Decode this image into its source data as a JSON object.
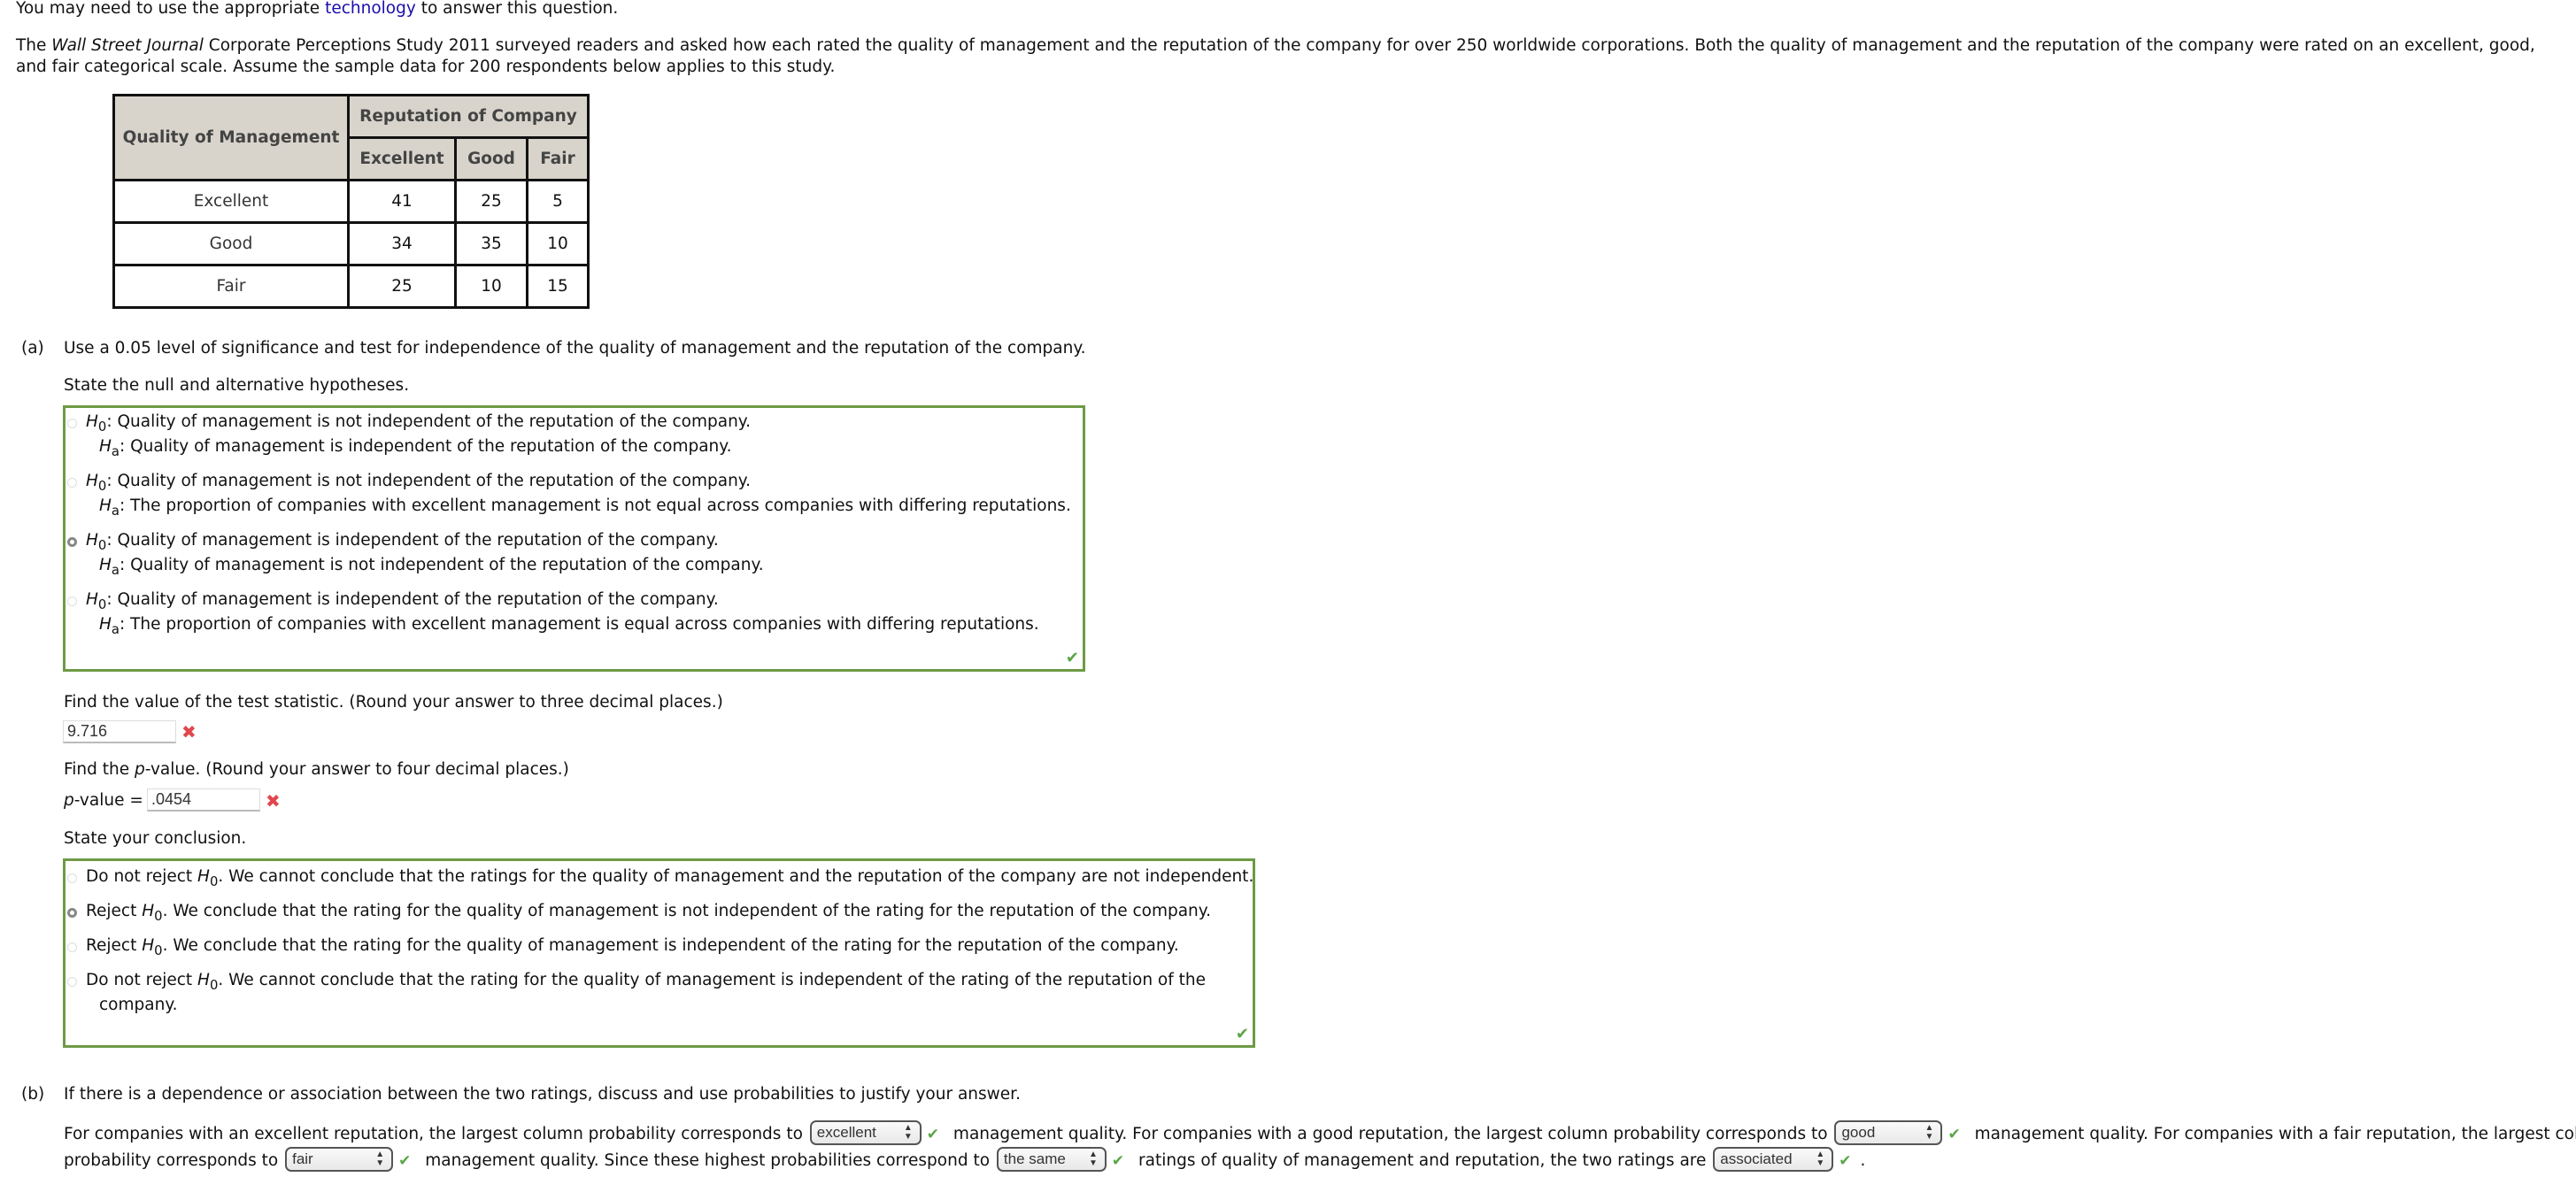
{
  "header": {
    "tech_prefix": "You may need to use the appropriate ",
    "tech_link": "technology",
    "tech_suffix": " to answer this question."
  },
  "intro": {
    "part1": "The ",
    "journal": "Wall Street Journal",
    "part2": " Corporate Perceptions Study 2011 surveyed readers and asked how each rated the quality of management and the reputation of the company for over 250 worldwide corporations. Both the quality of management and the reputation of the company were rated on an excellent, good, and fair categorical scale. Assume the sample data for 200 respondents below applies to this study."
  },
  "table": {
    "row_header": "Quality of Management",
    "col_group_header": "Reputation of Company",
    "columns": [
      "Excellent",
      "Good",
      "Fair"
    ],
    "rows": [
      {
        "label": "Excellent",
        "values": [
          "41",
          "25",
          "5"
        ]
      },
      {
        "label": "Good",
        "values": [
          "34",
          "35",
          "10"
        ]
      },
      {
        "label": "Fair",
        "values": [
          "25",
          "10",
          "15"
        ]
      }
    ]
  },
  "part_a": {
    "label": "(a)",
    "prompt": "Use a 0.05 level of significance and test for independence of the quality of management and the reputation of the company.",
    "hyp_prompt": "State the null and alternative hypotheses.",
    "h0_symbol": "H",
    "h0_sub": "0",
    "ha_symbol": "H",
    "ha_sub": "a",
    "hypotheses": [
      {
        "h0": ": Quality of management is not independent of the reputation of the company.",
        "ha": ": Quality of management is independent of the reputation of the company.",
        "selected": false
      },
      {
        "h0": ": Quality of management is not independent of the reputation of the company.",
        "ha": ": The proportion of companies with excellent management is not equal across companies with differing reputations.",
        "selected": false
      },
      {
        "h0": ": Quality of management is independent of the reputation of the company.",
        "ha": ": Quality of management is not independent of the reputation of the company.",
        "selected": true
      },
      {
        "h0": ": Quality of management is independent of the reputation of the company.",
        "ha": ": The proportion of companies with excellent management is equal across companies with differing reputations.",
        "selected": false
      }
    ],
    "hyp_status": "correct",
    "stat_prompt": "Find the value of the test statistic. (Round your answer to three decimal places.)",
    "stat_value": "9.716",
    "stat_status": "incorrect",
    "p_prompt_pre": "Find the ",
    "p_prompt_p": "p",
    "p_prompt_post": "-value. (Round your answer to four decimal places.)",
    "p_label_p": "p",
    "p_label_post": "-value = ",
    "p_value": ".0454",
    "p_status": "incorrect",
    "conclusion_prompt": "State your conclusion.",
    "conclusions": [
      {
        "pre": "Do not reject ",
        "post": ". We cannot conclude that the ratings for the quality of management and the reputation of the company are not independent.",
        "selected": false
      },
      {
        "pre": "Reject ",
        "post": ". We conclude that the rating for the quality of management is not independent of the rating for the reputation of the company.",
        "selected": true
      },
      {
        "pre": "Reject ",
        "post": ". We conclude that the rating for the quality of management is independent of the rating for the reputation of the company.",
        "selected": false
      },
      {
        "pre": "Do not reject ",
        "post": ". We cannot conclude that the rating for the quality of management is independent of the rating of the reputation of the",
        "post2": "company.",
        "selected": false
      }
    ],
    "conclusion_status": "correct"
  },
  "part_b": {
    "label": "(b)",
    "prompt": "If there is a dependence or association between the two ratings, discuss and use probabilities to justify your answer.",
    "s1": "For companies with an excellent reputation, the largest column probability corresponds to",
    "sel1": "excellent",
    "s2": "management quality. For companies with a good reputation, the largest column probability corresponds to",
    "sel2": "good",
    "s3": "management quality. For companies with a fair reputation, the largest column",
    "s4": "probability corresponds to",
    "sel3": "fair",
    "s5": "management quality. Since these highest probabilities correspond to",
    "sel4": "the same",
    "s6": "ratings of quality of management and reputation, the two ratings are",
    "sel5": "associated",
    "s7": "."
  },
  "icons": {
    "check": "✔",
    "cross": "✖",
    "select_arrows": "▲▼"
  },
  "colors": {
    "correct_green": "#6e9a45",
    "check_green": "#5aa646",
    "error_red": "#e0474c",
    "link_blue": "#1a0dab",
    "table_header_bg": "#d8d4cc"
  }
}
